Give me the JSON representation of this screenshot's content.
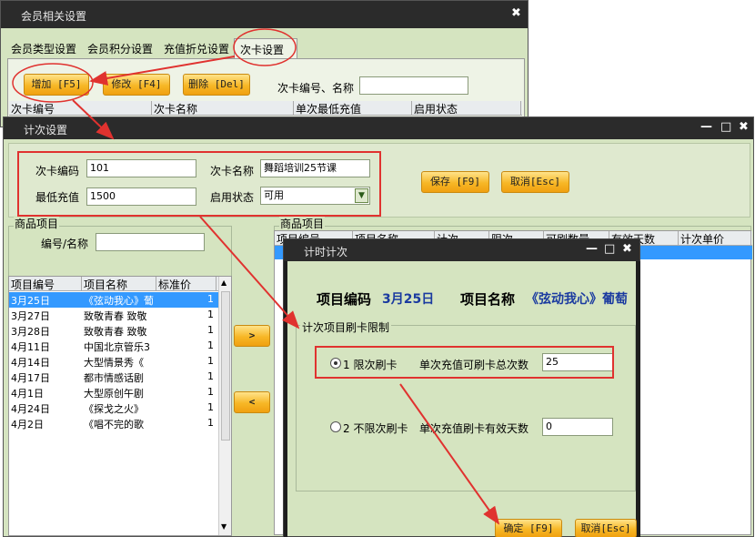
{
  "win1": {
    "title": "会员相关设置",
    "close": "✖",
    "tabs": [
      "会员类型设置",
      "会员积分设置",
      "充值折兑设置",
      "次卡设置"
    ],
    "add_btn": "增加 [F5]",
    "edit_btn": "修改 [F4]",
    "delete_btn": "删除 [Del]",
    "search_label": "次卡编号、名称",
    "search_value": "",
    "columns": [
      "次卡编号",
      "次卡名称",
      "单次最低充值",
      "启用状态"
    ]
  },
  "win2": {
    "title": "计次设置",
    "min": "—",
    "max": "□",
    "close": "✖",
    "code_label": "次卡编码",
    "code_value": "101",
    "name_label": "次卡名称",
    "name_value": "舞蹈培训25节课",
    "min_label": "最低充值",
    "min_value": "1500",
    "status_label": "启用状态",
    "status_value": "可用",
    "save_btn": "保存 [F9]",
    "cancel_btn": "取消[Esc]",
    "left_group": "商品项目",
    "filter_label": "编号/名称",
    "filter_value": "",
    "left_columns": [
      "项目编号",
      "项目名称",
      "标准价"
    ],
    "left_rows": [
      {
        "code": "3月25日",
        "name": "《弦动我心》葡",
        "price": "1"
      },
      {
        "code": "3月27日",
        "name": "致敬青春 致敬",
        "price": "1"
      },
      {
        "code": "3月28日",
        "name": "致敬青春 致敬",
        "price": "1"
      },
      {
        "code": "4月11日",
        "name": "中国北京管乐3",
        "price": "1"
      },
      {
        "code": "4月14日",
        "name": "大型情景秀《",
        "price": "1"
      },
      {
        "code": "4月17日",
        "name": "都市情感话剧",
        "price": "1"
      },
      {
        "code": "4月1日",
        "name": "大型原创午剧",
        "price": "1"
      },
      {
        "code": "4月24日",
        "name": "《探戈之火》",
        "price": "1"
      },
      {
        "code": "4月2日",
        "name": "《唱不完的歌",
        "price": "1"
      }
    ],
    "move_right": ">",
    "move_left": "<",
    "right_group": "商品项目",
    "right_columns": [
      "项目编号",
      "项目名称",
      "计次",
      "限次",
      "可刷数量",
      "有效天数",
      "计次单价"
    ]
  },
  "win3": {
    "title": "计时计次",
    "min": "—",
    "max": "□",
    "close": "✖",
    "item_code_label": "项目编码",
    "item_code_value": "3月25日",
    "item_name_label": "项目名称",
    "item_name_value": "《弦动我心》葡萄",
    "group_label": "计次项目刷卡限制",
    "opt1_label": "1 限次刷卡",
    "opt1_field_label": "单次充值可刷卡总次数",
    "opt1_value": "25",
    "opt2_label": "2 不限次刷卡",
    "opt2_field_label": "单次充值刷卡有效天数",
    "opt2_value": "0",
    "ok_btn": "确定 [F9]",
    "cancel_btn": "取消[Esc]"
  },
  "colors": {
    "panel_bg": "#d5e4c0",
    "titlebar": "#2b2b2b",
    "button": "#f7b726",
    "highlight": "#e0322f",
    "selected_row": "#3399ff"
  }
}
